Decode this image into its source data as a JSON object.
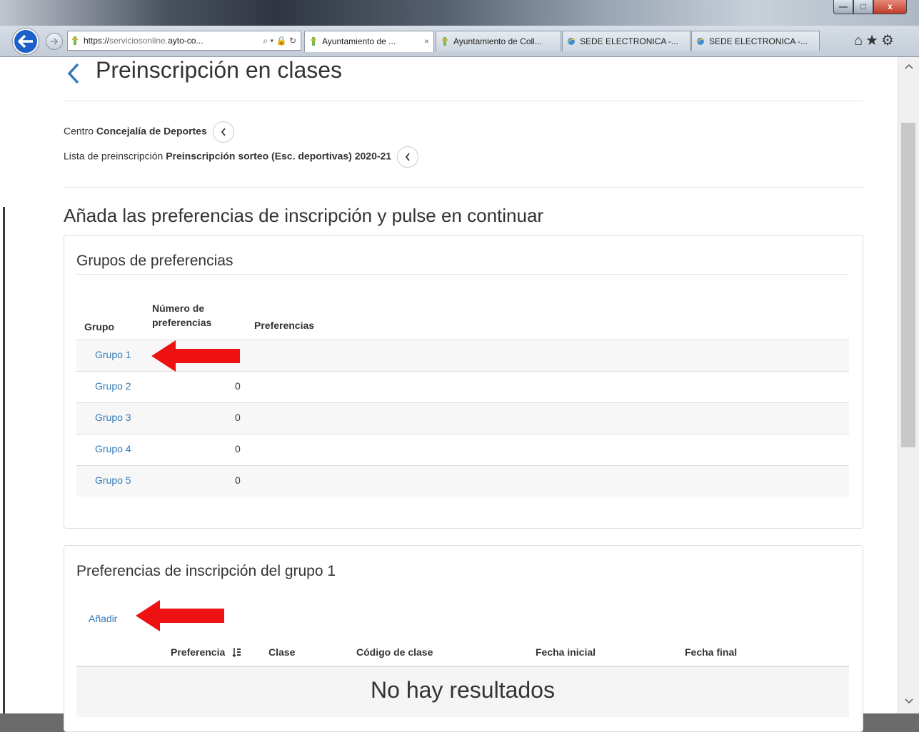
{
  "browser": {
    "address": {
      "url_prefix": "https://",
      "url_dim": "serviciosonline.",
      "url_main": "ayto-co...",
      "tools": "⌕ ▾ 🔒 ↻"
    },
    "tabs": [
      {
        "label": "Ayuntamiento de ...",
        "close": "×",
        "active": true
      },
      {
        "label": "Ayuntamiento de Coll...",
        "active": false
      },
      {
        "label": "SEDE ELECTRONICA -...",
        "active": false
      },
      {
        "label": "SEDE ELECTRONICA -...",
        "active": false
      }
    ],
    "toolbar_icons": "⌂★⚙",
    "window_controls": {
      "minimize": "—",
      "maximize": "□",
      "close": "x"
    }
  },
  "page": {
    "title": "Preinscripción en clases",
    "centro_label": "Centro",
    "centro_value": "Concejalía de Deportes",
    "lista_label": "Lista de preinscripción",
    "lista_value": "Preinscripción sorteo (Esc. deportivas) 2020-21",
    "instruction": "Añada las preferencias de inscripción y pulse en continuar"
  },
  "groups_panel": {
    "title": "Grupos de preferencias",
    "columns": {
      "grupo": "Grupo",
      "numero_line1": "Número de",
      "numero_line2": "preferencias",
      "preferencias": "Preferencias"
    },
    "rows": [
      {
        "name": "Grupo 1",
        "count": ""
      },
      {
        "name": "Grupo 2",
        "count": "0"
      },
      {
        "name": "Grupo 3",
        "count": "0"
      },
      {
        "name": "Grupo 4",
        "count": "0"
      },
      {
        "name": "Grupo 5",
        "count": "0"
      }
    ]
  },
  "prefs_panel": {
    "title": "Preferencias de inscripción del grupo 1",
    "add_link": "Añadir",
    "columns": {
      "preferencia": "Preferencia",
      "clase": "Clase",
      "codigo": "Código de clase",
      "fecha_inicial": "Fecha inicial",
      "fecha_final": "Fecha final"
    },
    "empty_text": "No hay resultados"
  },
  "colors": {
    "link": "#337ab7",
    "annotation_arrow": "#ee1111",
    "browser_back": "#1a60c8"
  }
}
